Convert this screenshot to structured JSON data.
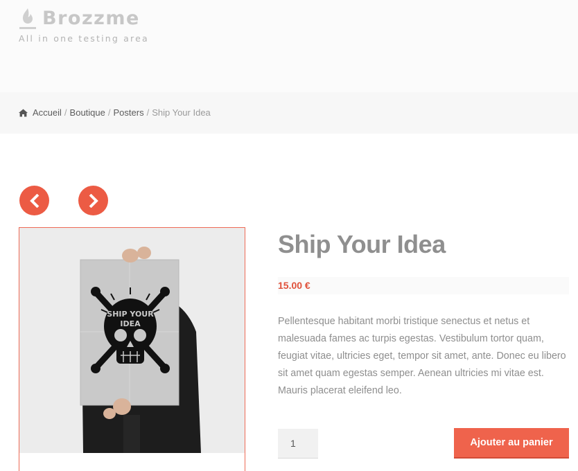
{
  "site": {
    "title": "Brozzme",
    "description": "All in one testing area",
    "logo_icon": "flame-logo-icon"
  },
  "breadcrumb": {
    "home_icon": "home-icon",
    "separator": "/",
    "items": [
      "Accueil",
      "Boutique",
      "Posters"
    ],
    "current": "Ship Your Idea"
  },
  "navigation": {
    "prev_icon": "chevron-left-icon",
    "next_icon": "chevron-right-icon"
  },
  "product": {
    "title": "Ship Your Idea",
    "price": "15.00 €",
    "description": "Pellentesque habitant morbi tristique senectus et netus et malesuada fames ac turpis egestas. Vestibulum tortor quam, feugiat vitae, ultricies eget, tempor sit amet, ante. Donec eu libero sit amet quam egestas semper. Aenean ultricies mi vitae est. Mauris placerat eleifend leo.",
    "image_text": [
      "SHIP YOUR",
      "IDEA"
    ],
    "quantity": "1",
    "add_to_cart_label": "Ajouter au panier"
  },
  "colors": {
    "accent": "#ef634c",
    "price": "#e0513b",
    "header_bg": "#fbfbfb",
    "breadcrumb_bg": "#f7f7f7"
  }
}
